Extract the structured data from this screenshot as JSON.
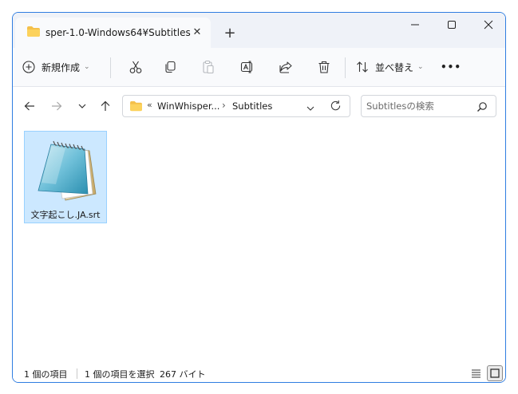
{
  "window": {
    "tab_title": "sper-1.0-Windows64¥Subtitles",
    "tab_close": "✕",
    "new_tab": "+",
    "controls": {
      "minimize": "minimize-icon",
      "maximize": "maximize-icon",
      "close": "close-icon"
    }
  },
  "toolbar": {
    "new_label": "新規作成",
    "sort_label": "並べ替え",
    "more_label": "•••",
    "caret": "⌄",
    "icons": [
      "cut-icon",
      "copy-icon",
      "paste-icon",
      "rename-icon",
      "share-icon",
      "delete-icon"
    ]
  },
  "address": {
    "overflow": "«",
    "crumbs": [
      "WinWhisper...",
      "Subtitles"
    ],
    "separator": "›"
  },
  "search": {
    "placeholder": "Subtitlesの検索"
  },
  "files": [
    {
      "name": "文字起こし.JA.srt",
      "icon": "notepad-file-icon",
      "selected": true
    }
  ],
  "status": {
    "item_count": "1 個の項目",
    "selected": "1 個の項目を選択",
    "size": "267 バイト"
  },
  "colors": {
    "accent_border": "#2f7de1",
    "folder": "#f4c04a",
    "selection_bg": "#cce8ff",
    "selection_border": "#99d1ff"
  }
}
